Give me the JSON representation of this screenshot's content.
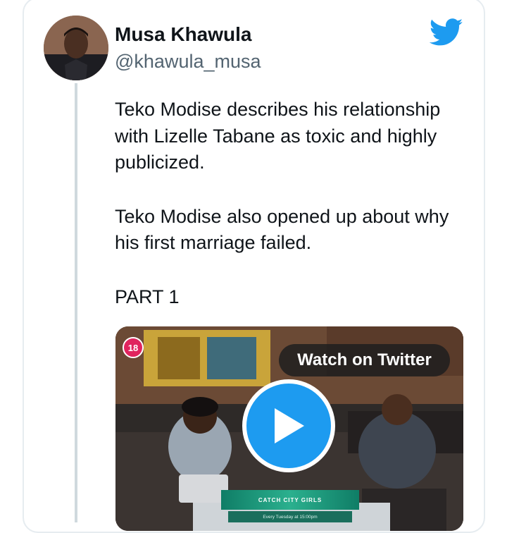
{
  "tweet": {
    "author": {
      "display_name": "Musa Khawula",
      "handle": "@khawula_musa"
    },
    "paragraphs": [
      "Teko Modise describes his relationship with Lizelle Tabane as toxic and highly publicized.",
      "Teko Modise also opened up about why his first marriage failed.",
      "PART 1"
    ],
    "media": {
      "age_badge": "18",
      "watch_label": "Watch on Twitter",
      "banner_title": "CATCH CITY GIRLS",
      "banner_subtitle": "Every Tuesday at 15:00pm"
    }
  },
  "icons": {
    "brand": "twitter-bird-icon",
    "play": "play-icon"
  },
  "colors": {
    "twitter_blue": "#1d9bf0",
    "text": "#0f1419",
    "secondary_text": "#536471",
    "age_badge": "#e0245e"
  }
}
